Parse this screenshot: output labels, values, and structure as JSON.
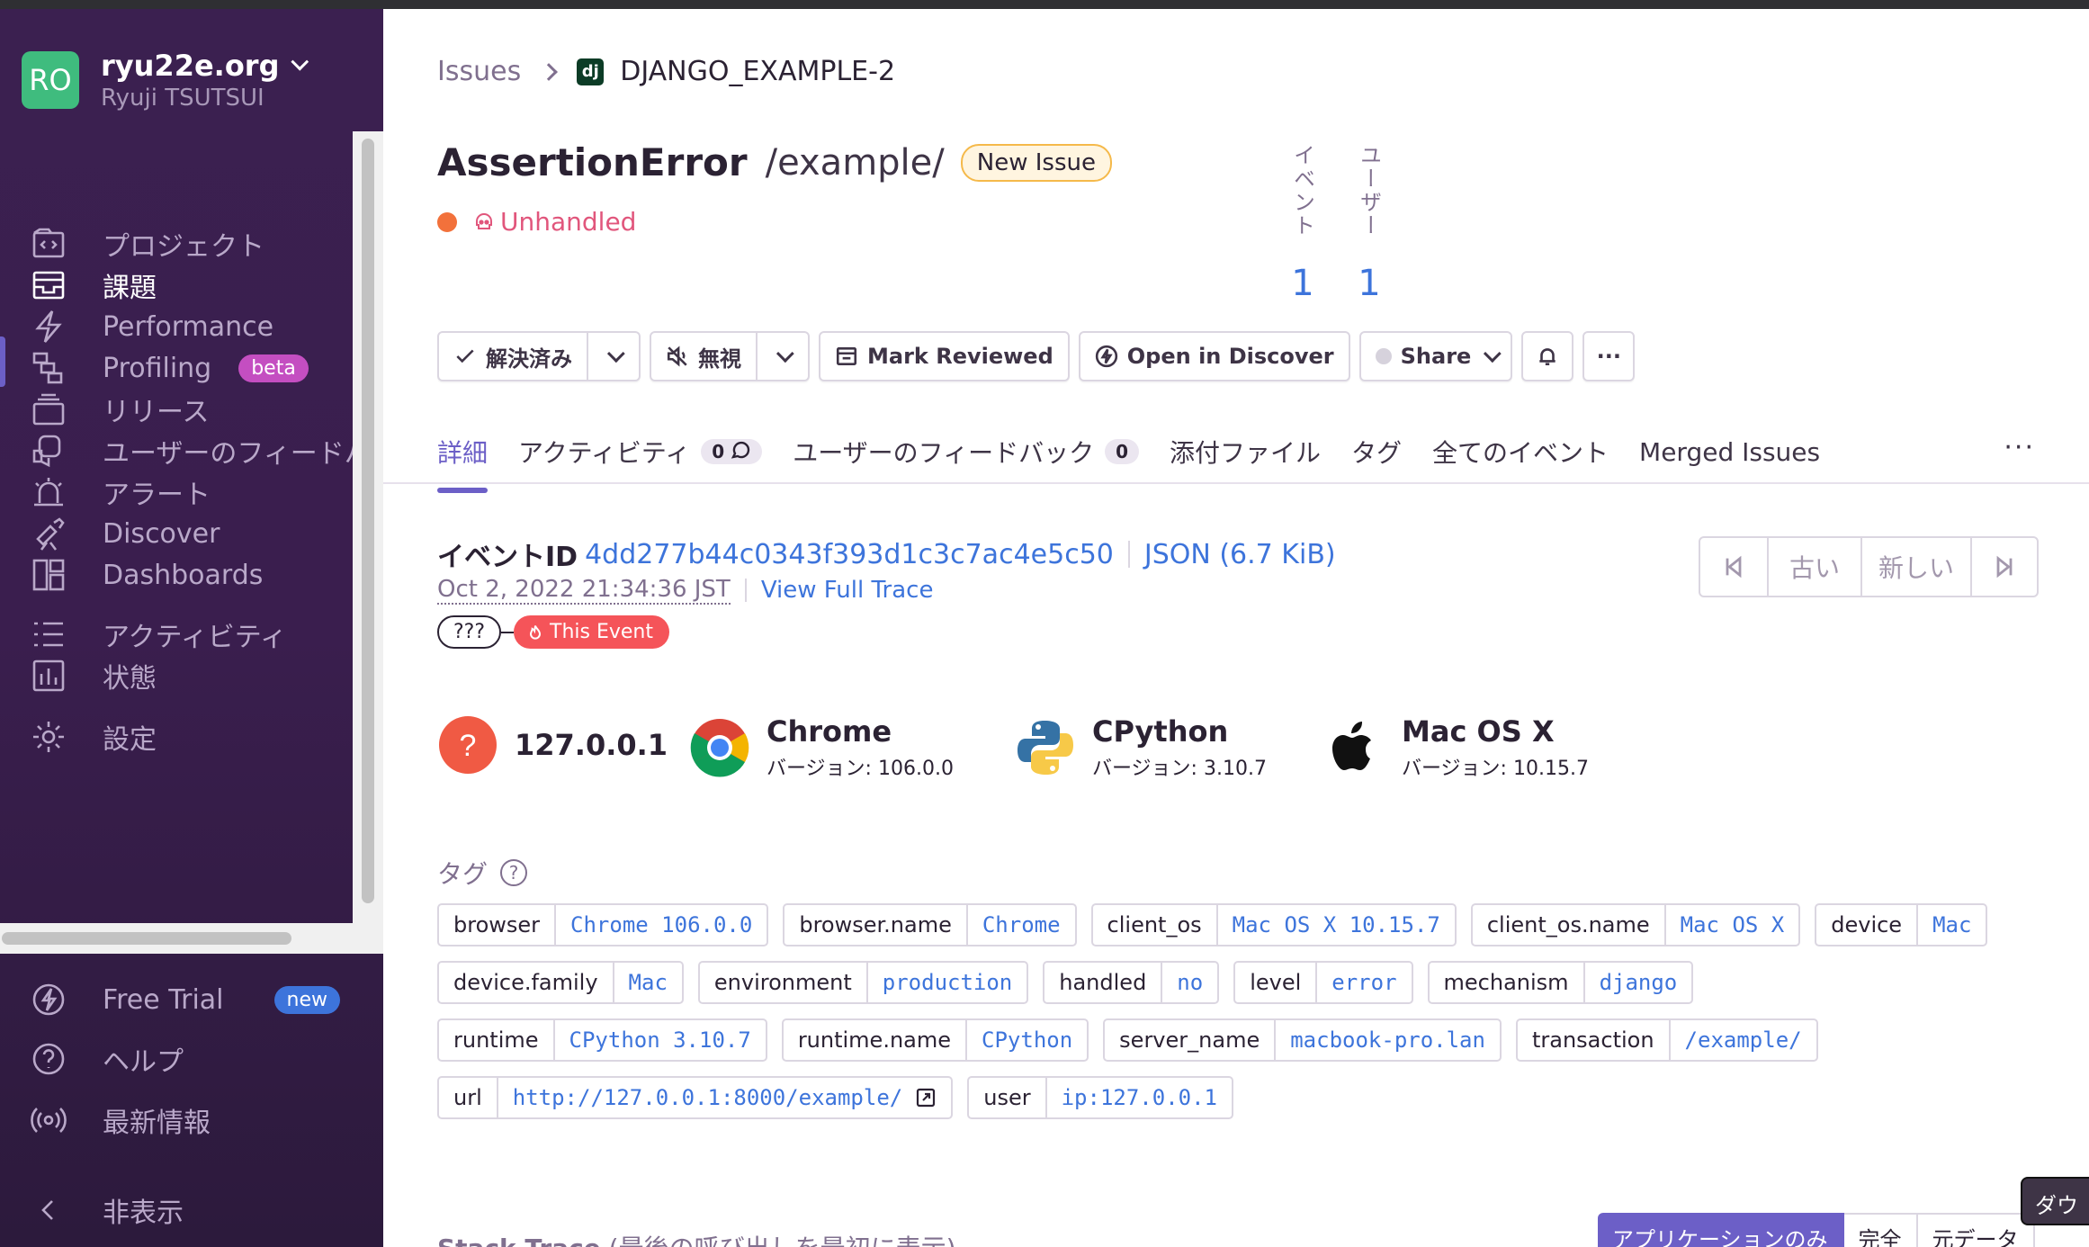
{
  "org": {
    "avatar": "RO",
    "name": "ryu22e.org",
    "user": "Ryuji TSUTSUI"
  },
  "sidebar": {
    "items": [
      {
        "label": "プロジェクト",
        "icon": "projects-icon"
      },
      {
        "label": "課題",
        "icon": "issues-icon",
        "active": true
      },
      {
        "label": "Performance",
        "icon": "performance-icon"
      },
      {
        "label": "Profiling",
        "icon": "profiling-icon",
        "badge": "beta"
      },
      {
        "label": "リリース",
        "icon": "releases-icon"
      },
      {
        "label": "ユーザーのフィードバック",
        "icon": "feedback-icon"
      },
      {
        "label": "アラート",
        "icon": "alerts-icon"
      },
      {
        "label": "Discover",
        "icon": "discover-icon"
      },
      {
        "label": "Dashboards",
        "icon": "dashboards-icon"
      },
      {
        "label": "アクティビティ",
        "icon": "activity-icon"
      },
      {
        "label": "状態",
        "icon": "stats-icon"
      },
      {
        "label": "設定",
        "icon": "settings-icon"
      }
    ],
    "bottom": [
      {
        "label": "Free Trial",
        "icon": "lightning-icon",
        "badge": "new"
      },
      {
        "label": "ヘルプ",
        "icon": "help-icon"
      },
      {
        "label": "最新情報",
        "icon": "broadcast-icon"
      },
      {
        "label": "非表示",
        "icon": "chevron-left-icon"
      }
    ]
  },
  "breadcrumb": {
    "root": "Issues",
    "project": "DJANGO_EXAMPLE-2",
    "project_icon": "dj"
  },
  "issue": {
    "title": "AssertionError",
    "culprit": "/example/",
    "badge": "New Issue",
    "status": "Unhandled"
  },
  "stats": {
    "events_label": "イベント",
    "events": "1",
    "users_label": "ユーザー",
    "users": "1"
  },
  "actions": {
    "resolve": "解決済み",
    "ignore": "無視",
    "mark_reviewed": "Mark Reviewed",
    "open_discover": "Open in Discover",
    "share": "Share",
    "more": "···"
  },
  "tabs": [
    {
      "label": "詳細",
      "active": true
    },
    {
      "label": "アクティビティ",
      "count": "0",
      "comment": true
    },
    {
      "label": "ユーザーのフィードバック",
      "count": "0"
    },
    {
      "label": "添付ファイル"
    },
    {
      "label": "タグ"
    },
    {
      "label": "全てのイベント"
    },
    {
      "label": "Merged Issues"
    }
  ],
  "tabs_more": "···",
  "event": {
    "id_label": "イベントID",
    "id": "4dd277b44c0343f393d1c3c7ac4e5c50",
    "json": "JSON (6.7 KiB)",
    "date": "Oct 2, 2022 21:34:36 JST",
    "trace_link": "View Full Trace",
    "trace_unknown": "???",
    "this_event": "This Event"
  },
  "pager": {
    "older": "古い",
    "newer": "新しい"
  },
  "contexts": [
    {
      "title": "127.0.0.1",
      "sub": "",
      "icon": "user-unknown-icon"
    },
    {
      "title": "Chrome",
      "sub": "バージョン: 106.0.0",
      "icon": "chrome-icon"
    },
    {
      "title": "CPython",
      "sub": "バージョン: 3.10.7",
      "icon": "python-icon"
    },
    {
      "title": "Mac OS X",
      "sub": "バージョン: 10.15.7",
      "icon": "apple-icon"
    }
  ],
  "tags_heading": "タグ",
  "tags": [
    {
      "k": "browser",
      "v": "Chrome 106.0.0"
    },
    {
      "k": "browser.name",
      "v": "Chrome"
    },
    {
      "k": "client_os",
      "v": "Mac OS X 10.15.7"
    },
    {
      "k": "client_os.name",
      "v": "Mac OS X"
    },
    {
      "k": "device",
      "v": "Mac"
    },
    {
      "k": "device.family",
      "v": "Mac"
    },
    {
      "k": "environment",
      "v": "production"
    },
    {
      "k": "handled",
      "v": "no"
    },
    {
      "k": "level",
      "v": "error"
    },
    {
      "k": "mechanism",
      "v": "django"
    },
    {
      "k": "runtime",
      "v": "CPython 3.10.7"
    },
    {
      "k": "runtime.name",
      "v": "CPython"
    },
    {
      "k": "server_name",
      "v": "macbook-pro.lan"
    },
    {
      "k": "transaction",
      "v": "/example/"
    },
    {
      "k": "url",
      "v": "http://127.0.0.1:8000/example/",
      "external": true
    },
    {
      "k": "user",
      "v": "ip:127.0.0.1"
    }
  ],
  "stack": {
    "title": "Stack Trace",
    "note": "(最後の呼び出しを最初に表示)",
    "seg_app": "アプリケーションのみ",
    "seg_full": "完全",
    "seg_raw": "元データ"
  },
  "tooltip": "ダウ",
  "colors": {
    "accent": "#6c5fc7",
    "link": "#3d74db",
    "sidebar": "#3b2050",
    "unhandled": "#e1567c"
  }
}
